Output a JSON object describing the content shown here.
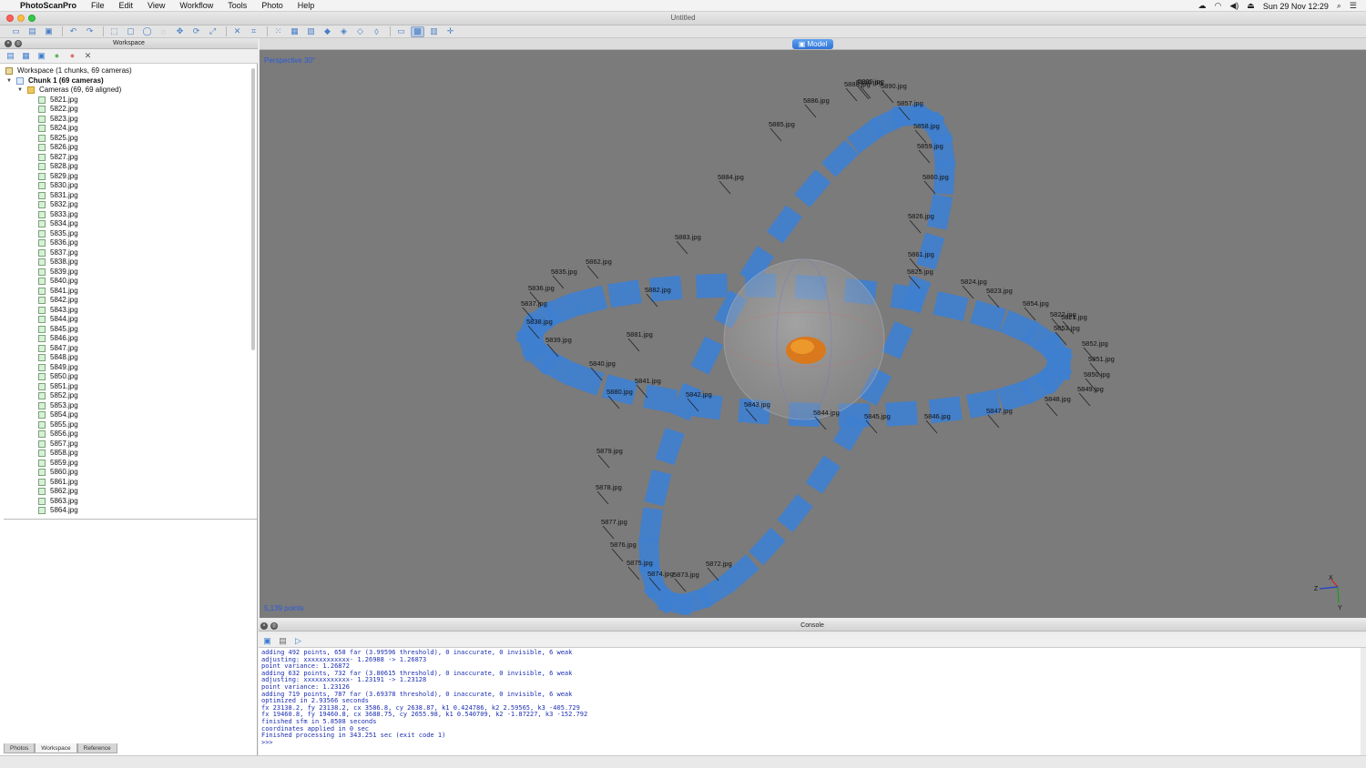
{
  "menubar": {
    "app_name": "PhotoScanPro",
    "items": [
      "File",
      "Edit",
      "View",
      "Workflow",
      "Tools",
      "Photo",
      "Help"
    ],
    "clock": "Sun 29 Nov  12:29"
  },
  "window": {
    "title": "Untitled"
  },
  "workspace_panel": {
    "title": "Workspace",
    "root_label": "Workspace (1 chunks, 69 cameras)",
    "chunk_label": "Chunk 1 (69 cameras)",
    "cameras_label": "Cameras (69, 69 aligned)",
    "cameras": [
      "5821.jpg",
      "5822.jpg",
      "5823.jpg",
      "5824.jpg",
      "5825.jpg",
      "5826.jpg",
      "5827.jpg",
      "5828.jpg",
      "5829.jpg",
      "5830.jpg",
      "5831.jpg",
      "5832.jpg",
      "5833.jpg",
      "5834.jpg",
      "5835.jpg",
      "5836.jpg",
      "5837.jpg",
      "5838.jpg",
      "5839.jpg",
      "5840.jpg",
      "5841.jpg",
      "5842.jpg",
      "5843.jpg",
      "5844.jpg",
      "5845.jpg",
      "5846.jpg",
      "5847.jpg",
      "5848.jpg",
      "5849.jpg",
      "5850.jpg",
      "5851.jpg",
      "5852.jpg",
      "5853.jpg",
      "5854.jpg",
      "5855.jpg",
      "5856.jpg",
      "5857.jpg",
      "5858.jpg",
      "5859.jpg",
      "5860.jpg",
      "5861.jpg",
      "5862.jpg",
      "5863.jpg",
      "5864.jpg"
    ],
    "bottom_tabs": [
      "Photos",
      "Workspace",
      "Reference"
    ],
    "active_tab": "Workspace"
  },
  "model_view": {
    "tab_label": "Model",
    "projection": "Perspective 30°",
    "point_count": "5,139 points",
    "axis_labels": [
      "X",
      "Z",
      "Y"
    ],
    "camera_labels": [
      "5886.jpg",
      "5888.jpg",
      "5889.jpg",
      "5890.jpg",
      "5856.jpg",
      "5857.jpg",
      "5858.jpg",
      "5859.jpg",
      "5860.jpg",
      "5885.jpg",
      "5884.jpg",
      "5883.jpg",
      "5882.jpg",
      "5881.jpg",
      "5880.jpg",
      "5879.jpg",
      "5878.jpg",
      "5877.jpg",
      "5876.jpg",
      "5875.jpg",
      "5874.jpg",
      "5873.jpg",
      "5872.jpg",
      "5835.jpg",
      "5836.jpg",
      "5837.jpg",
      "5838.jpg",
      "5839.jpg",
      "5840.jpg",
      "5841.jpg",
      "5842.jpg",
      "5843.jpg",
      "5844.jpg",
      "5845.jpg",
      "5846.jpg",
      "5847.jpg",
      "5848.jpg",
      "5849.jpg",
      "5850.jpg",
      "5851.jpg",
      "5852.jpg",
      "5853.jpg",
      "5821.jpg",
      "5822.jpg",
      "5854.jpg",
      "5823.jpg",
      "5824.jpg",
      "5825.jpg",
      "5826.jpg",
      "5861.jpg",
      "5862.jpg",
      "5834.jpg"
    ]
  },
  "console": {
    "title": "Console",
    "lines": [
      "adding 492 points, 658 far (3.99596 threshold), 0 inaccurate, 0 invisible, 6 weak",
      "adjusting: xxxxxxxxxxxx- 1.26988 -> 1.26873",
      "point variance: 1.26872",
      "adding 632 points, 732 far (3.80615 threshold), 0 inaccurate, 0 invisible, 6 weak",
      "adjusting: xxxxxxxxxxxx- 1.23191 -> 1.23128",
      "point variance: 1.23126",
      "adding 719 points, 787 far (3.69378 threshold), 0 inaccurate, 0 invisible, 6 weak",
      "optimized in 2.93566 seconds",
      "fx 23138.2, fy 23138.2, cx 3586.8, cy 2638.87, k1 0.424786, k2 2.59565, k3 -405.729",
      "fx 19460.8, fy 19460.8, cx 3688.75, cy 2655.98, k1 0.540709, k2 -1.87227, k3 -152.792",
      "finished sfm in 5.8508 seconds",
      "coordinates applied in 0 sec",
      "Finished processing in 343.251 sec (exit code 1)",
      ">>>"
    ]
  },
  "colors": {
    "camera_plane": "#3f7fcf",
    "viewport_bg": "#7b7b7b",
    "console_text": "#1c2fb0",
    "accent": "#2f73d6"
  }
}
